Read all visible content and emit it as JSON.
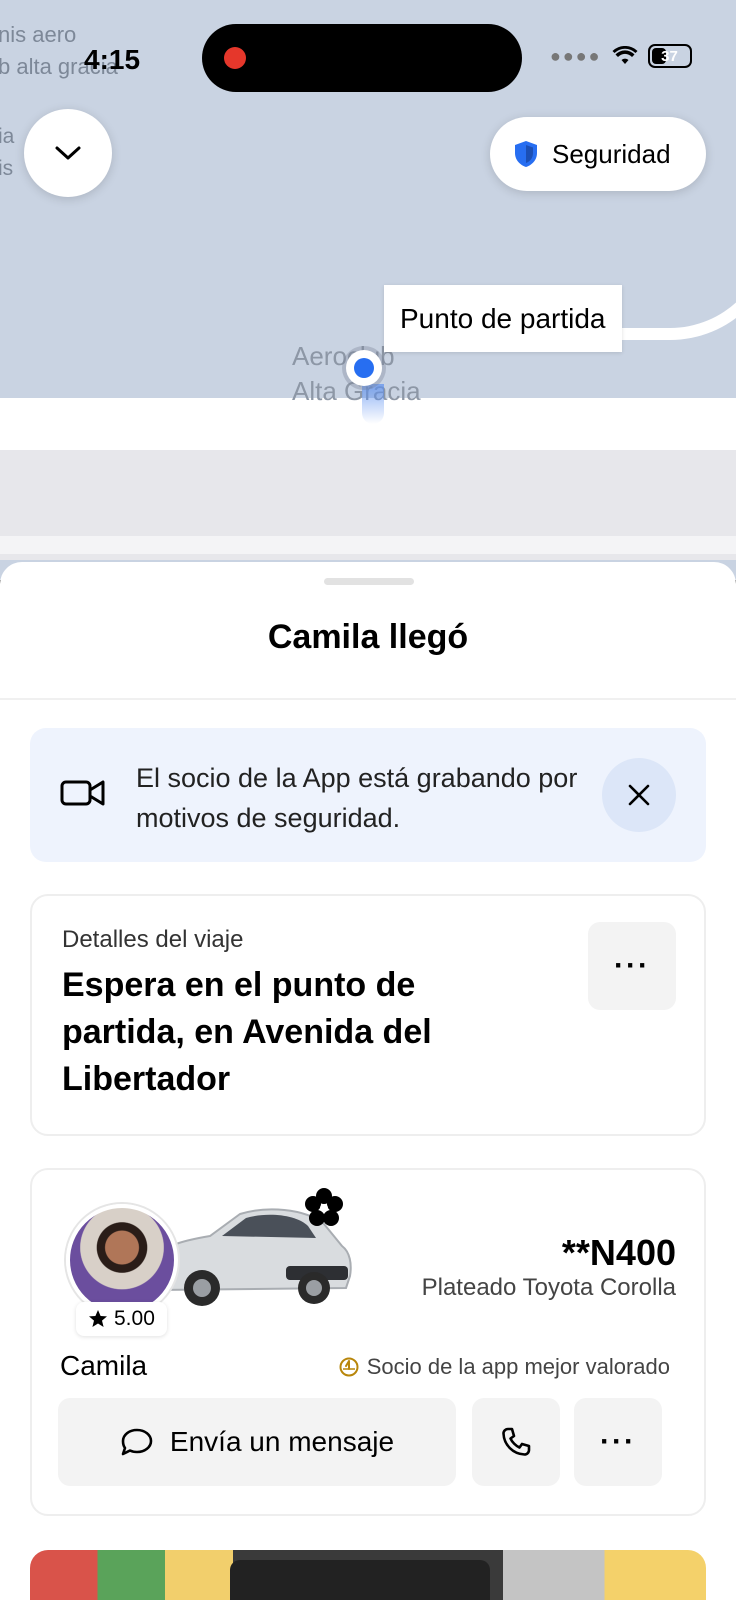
{
  "status_bar": {
    "time": "4:15",
    "battery": "37",
    "battery_level": 0.37
  },
  "map": {
    "labels": [
      "nis aero",
      "b alta gracia",
      "ia",
      "is"
    ],
    "place_line1": "Aeroclub",
    "place_line2": "Alta Gracia",
    "pickup_tag": "Punto de partida"
  },
  "safety_button": {
    "label": "Seguridad"
  },
  "sheet": {
    "title": "Camila llegó",
    "banner": {
      "text": "El socio de la App está grabando por motivos de seguridad."
    },
    "trip": {
      "label": "Detalles del viaje",
      "instruction": "Espera en el punto de partida, en Avenida del Libertador",
      "more": "···"
    },
    "driver": {
      "name": "Camila",
      "rating": "5.00",
      "plate": "**N400",
      "car": "Plateado Toyota Corolla",
      "top_rated": "Socio de la app mejor valorado",
      "message_button": "Envía un mensaje",
      "more": "···"
    }
  },
  "colors": {
    "accent_blue": "#276ef1",
    "banner_bg": "#eef3fd",
    "map_bg": "#c9d3e2"
  }
}
